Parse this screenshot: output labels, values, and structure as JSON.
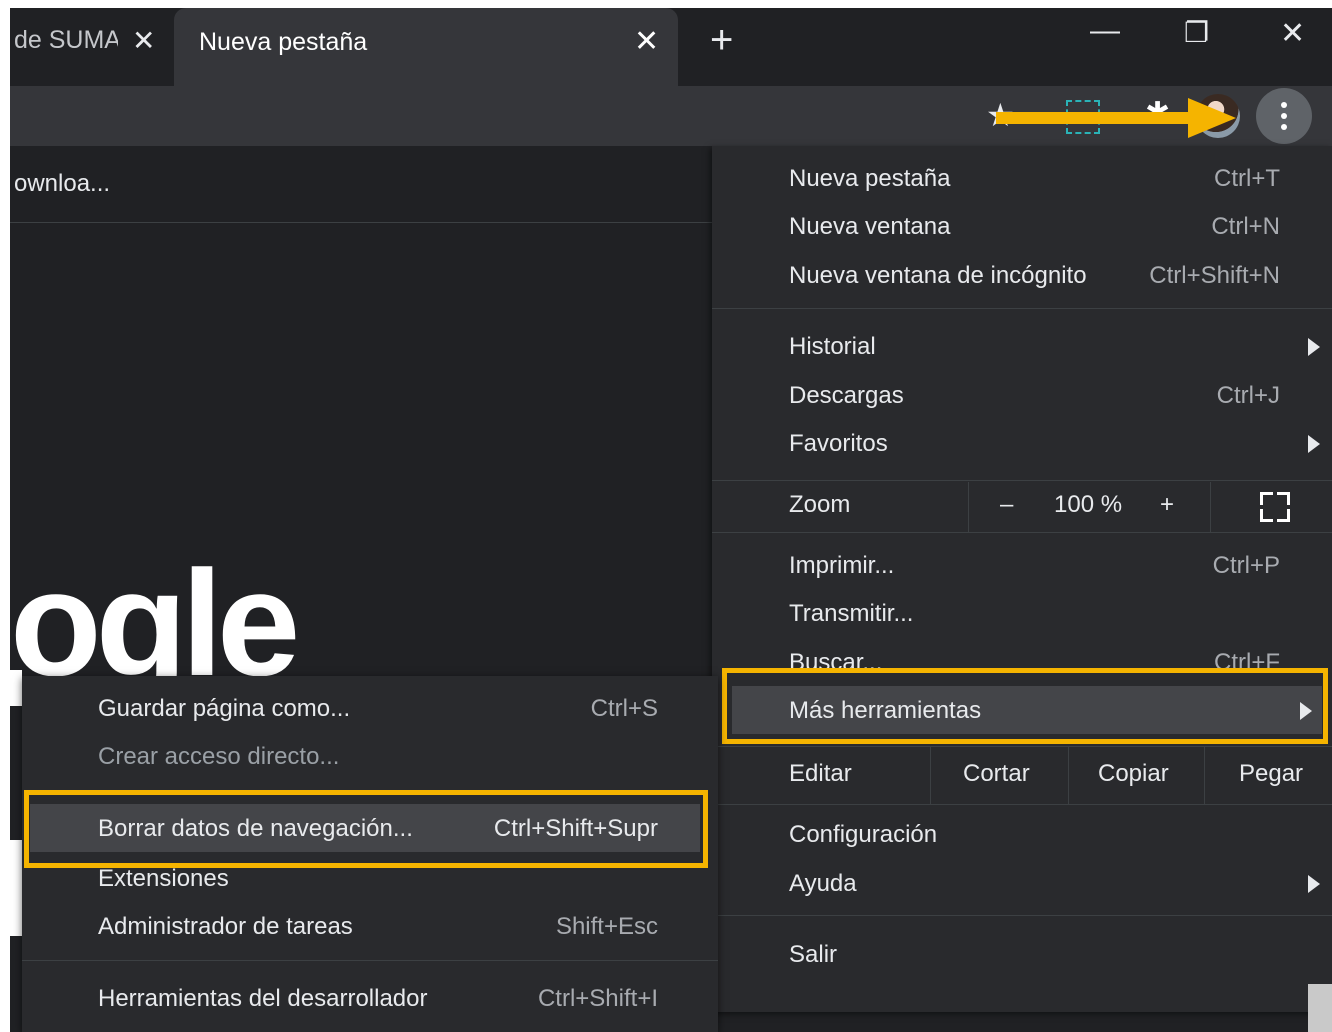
{
  "tabs": [
    {
      "title": "de SUMA",
      "close_icon": "close-icon",
      "active": false
    },
    {
      "title": "Nueva pestaña",
      "close_icon": "close-icon",
      "active": true
    }
  ],
  "new_tab_glyph": "+",
  "window_controls": {
    "minimize": "—",
    "restore": "❐",
    "close": "✕"
  },
  "bookmark_bar": {
    "item": "ownloa..."
  },
  "page_logo_text": "ogle",
  "toolbar_icons": [
    "star-icon",
    "screenshot-icon",
    "extensions-icon",
    "avatar",
    "menu-kebab-icon"
  ],
  "menu": {
    "group1": [
      {
        "label": "Nueva pestaña",
        "shortcut": "Ctrl+T"
      },
      {
        "label": "Nueva ventana",
        "shortcut": "Ctrl+N"
      },
      {
        "label": "Nueva ventana de incógnito",
        "shortcut": "Ctrl+Shift+N"
      }
    ],
    "group2": [
      {
        "label": "Historial",
        "shortcut": "",
        "submenu": true
      },
      {
        "label": "Descargas",
        "shortcut": "Ctrl+J"
      },
      {
        "label": "Favoritos",
        "shortcut": "",
        "submenu": true
      }
    ],
    "zoom": {
      "label": "Zoom",
      "minus": "–",
      "value": "100 %",
      "plus": "+"
    },
    "group3": [
      {
        "label": "Imprimir...",
        "shortcut": "Ctrl+P"
      },
      {
        "label": "Transmitir...",
        "shortcut": ""
      },
      {
        "label": "Buscar...",
        "shortcut": "Ctrl+F"
      },
      {
        "label": "Más herramientas",
        "shortcut": "",
        "submenu": true
      }
    ],
    "edit": {
      "label": "Editar",
      "cut": "Cortar",
      "copy": "Copiar",
      "paste": "Pegar"
    },
    "group4": [
      {
        "label": "Configuración",
        "shortcut": ""
      },
      {
        "label": "Ayuda",
        "shortcut": "",
        "submenu": true
      }
    ],
    "exit": {
      "label": "Salir"
    }
  },
  "submenu": {
    "items": [
      {
        "label": "Guardar página como...",
        "shortcut": "Ctrl+S",
        "disabled": false
      },
      {
        "label": "Crear acceso directo...",
        "shortcut": "",
        "disabled": true
      },
      {
        "label": "Borrar datos de navegación...",
        "shortcut": "Ctrl+Shift+Supr",
        "disabled": false
      },
      {
        "label": "Extensiones",
        "shortcut": "",
        "disabled": false
      },
      {
        "label": "Administrador de tareas",
        "shortcut": "Shift+Esc",
        "disabled": false
      }
    ],
    "dev": {
      "label": "Herramientas del desarrollador",
      "shortcut": "Ctrl+Shift+I"
    }
  },
  "colors": {
    "highlight": "#f5b400",
    "menu_bg": "#292a2d",
    "hover_bg": "#444549",
    "arrow": "#f5b400"
  }
}
